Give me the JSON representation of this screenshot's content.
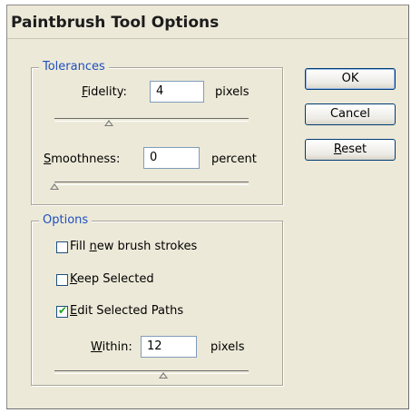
{
  "dialog": {
    "title": "Paintbrush Tool Options"
  },
  "tolerances": {
    "legend": "Tolerances",
    "fidelity": {
      "label_accel": "F",
      "label_rest": "idelity:",
      "value": "4",
      "unit": "pixels",
      "slider_level": 0.28
    },
    "smoothness": {
      "label_accel": "S",
      "label_rest": "moothness:",
      "value": "0",
      "unit": "percent",
      "slider_level": 0.0
    }
  },
  "options": {
    "legend": "Options",
    "fill_new": {
      "label_pre": "Fill ",
      "label_accel": "n",
      "label_post": "ew brush strokes",
      "checked": false
    },
    "keep_selected": {
      "label_accel": "K",
      "label_post": "eep Selected",
      "checked": false
    },
    "edit_selected": {
      "label_accel": "E",
      "label_post": "dit Selected Paths",
      "checked": true
    },
    "within": {
      "label_accel": "W",
      "label_rest": "ithin:",
      "value": "12",
      "unit": "pixels",
      "slider_level": 0.56
    }
  },
  "buttons": {
    "ok": "OK",
    "cancel": "Cancel",
    "reset_accel": "R",
    "reset_rest": "eset"
  },
  "checkmark_glyph": "✔"
}
